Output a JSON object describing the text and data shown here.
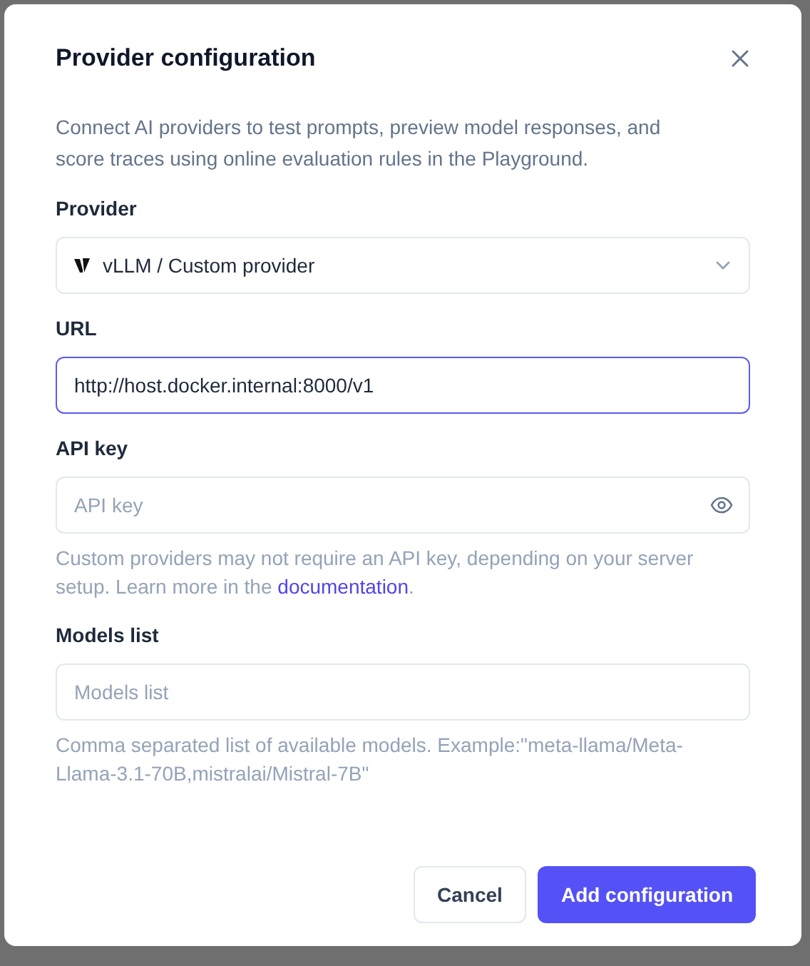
{
  "dialog": {
    "title": "Provider configuration",
    "description": "Connect AI providers to test prompts, preview model responses, and score traces using online evaluation rules in the Playground."
  },
  "fields": [
    {
      "kind": "select",
      "label": "Provider",
      "value": "vLLM / Custom provider",
      "focused": false
    },
    {
      "kind": "text",
      "label": "URL",
      "value": "http://host.docker.internal:8000/v1",
      "focused": true
    },
    {
      "kind": "password",
      "label": "API key",
      "placeholder": "API key",
      "focused": false,
      "help": {
        "before": "Custom providers may not require an API key, depending on your server setup. Learn more in the ",
        "link": "documentation",
        "after": "."
      }
    },
    {
      "kind": "text",
      "label": "Models list",
      "placeholder": "Models list",
      "focused": false,
      "help": {
        "before": "Comma separated list of available models. Example:\"meta-llama/Meta-Llama-3.1-70B,mistralai/Mistral-7B\""
      }
    }
  ],
  "buttons": [
    {
      "label": "Cancel",
      "kind": "secondary"
    },
    {
      "label": "Add configuration",
      "kind": "primary"
    }
  ]
}
